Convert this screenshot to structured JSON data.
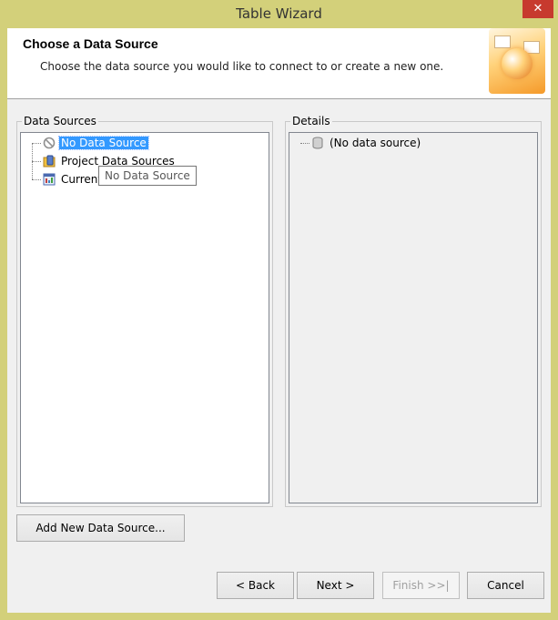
{
  "window": {
    "title": "Table Wizard",
    "close_glyph": "✕"
  },
  "header": {
    "title": "Choose a Data Source",
    "description": "Choose the data source you would like to connect to or create a new one."
  },
  "data_sources": {
    "group_label": "Data Sources",
    "items": [
      {
        "label": "No Data Source",
        "icon": "no-entry-icon",
        "selected": true
      },
      {
        "label": "Project Data Sources",
        "icon": "database-folder-icon",
        "selected": false
      },
      {
        "label": "Current",
        "icon": "report-icon",
        "selected": false
      }
    ],
    "tooltip": "No Data Source"
  },
  "details": {
    "group_label": "Details",
    "items": [
      {
        "label": "(No data source)",
        "icon": "database-icon"
      }
    ]
  },
  "buttons": {
    "add_new": "Add New Data Source...",
    "back": "< Back",
    "next": "Next >",
    "finish": "Finish >>|",
    "cancel": "Cancel"
  },
  "colors": {
    "title_bar": "#d3d07a",
    "selection": "#3399ff",
    "close_button": "#c73a2e"
  }
}
